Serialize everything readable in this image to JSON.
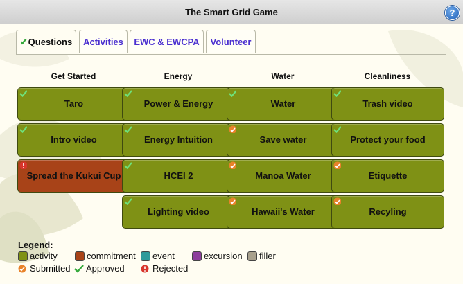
{
  "window": {
    "title": "The Smart Grid Game",
    "help_label": "?"
  },
  "tabs": [
    "Questions",
    "Activities",
    "EWC & EWCPA",
    "Volunteer"
  ],
  "columns": [
    {
      "heading": "Get Started",
      "items": [
        {
          "label": "Taro",
          "type": "activity",
          "status": "approved"
        },
        {
          "label": "Intro video",
          "type": "activity",
          "status": "approved"
        },
        {
          "label": "Spread the Kukui Cup",
          "type": "commitment",
          "status": "rejected"
        }
      ]
    },
    {
      "heading": "Energy",
      "items": [
        {
          "label": "Power & Energy",
          "type": "activity",
          "status": "approved"
        },
        {
          "label": "Energy Intuition",
          "type": "activity",
          "status": "approved"
        },
        {
          "label": "HCEI 2",
          "type": "activity",
          "status": "approved"
        },
        {
          "label": "Lighting video",
          "type": "activity",
          "status": "approved"
        }
      ]
    },
    {
      "heading": "Water",
      "items": [
        {
          "label": "Water",
          "type": "activity",
          "status": "approved"
        },
        {
          "label": "Save water",
          "type": "activity",
          "status": "submitted"
        },
        {
          "label": "Manoa Water",
          "type": "activity",
          "status": "submitted"
        },
        {
          "label": "Hawaii's Water",
          "type": "activity",
          "status": "submitted"
        }
      ]
    },
    {
      "heading": "Cleanliness",
      "items": [
        {
          "label": "Trash video",
          "type": "activity",
          "status": "approved"
        },
        {
          "label": "Protect your food",
          "type": "activity",
          "status": "approved"
        },
        {
          "label": "Etiquette",
          "type": "activity",
          "status": "submitted"
        },
        {
          "label": "Recyling",
          "type": "activity",
          "status": "submitted"
        }
      ]
    }
  ],
  "legend": {
    "title": "Legend:",
    "types": [
      {
        "label": "activity",
        "color": "#7f9115"
      },
      {
        "label": "commitment",
        "color": "#a84318"
      },
      {
        "label": "event",
        "color": "#2f9a9a"
      },
      {
        "label": "excursion",
        "color": "#8d3e9c"
      },
      {
        "label": "filler",
        "color": "#a8a08c"
      }
    ],
    "statuses": [
      {
        "label": "Submitted",
        "icon": "submitted-icon"
      },
      {
        "label": "Approved",
        "icon": "approved-icon"
      },
      {
        "label": "Rejected",
        "icon": "rejected-icon"
      }
    ]
  },
  "colors": {
    "activity": "#7f9115",
    "commitment": "#a84318",
    "approved": "#35a93c",
    "submitted": "#e8822a",
    "rejected": "#d8342b",
    "tab_text": "#4a2fd0"
  }
}
